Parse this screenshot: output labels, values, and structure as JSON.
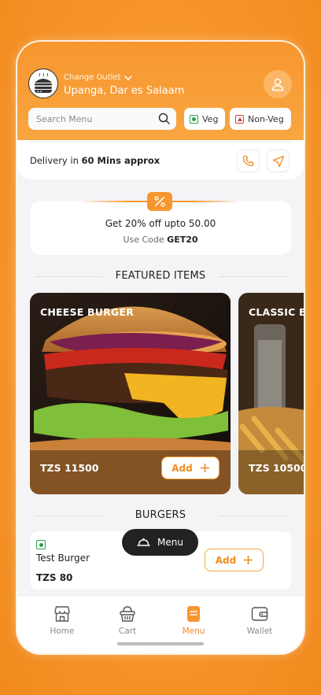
{
  "colors": {
    "accent": "#f7962f",
    "veg": "#2aa14a",
    "non_veg": "#d63b3b",
    "fab": "#222222"
  },
  "header": {
    "outlet_label": "Change Outlet",
    "outlet_name": "Upanga, Dar es Salaam",
    "search_placeholder": "Search Menu",
    "filters": {
      "veg": "Veg",
      "non_veg": "Non-Veg"
    }
  },
  "delivery": {
    "prefix": "Delivery in ",
    "time": "60 Mins approx"
  },
  "promo": {
    "title": "Get 20% off upto 50.00",
    "code_prefix": "Use Code ",
    "code": "GET20"
  },
  "featured": {
    "title": "FEATURED ITEMS",
    "items": [
      {
        "name": "CHEESE BURGER",
        "price": "TZS 11500",
        "add_label": "Add"
      },
      {
        "name": "CLASSIC BURGER",
        "price": "TZS 10500"
      }
    ]
  },
  "burgers": {
    "title": "BURGERS",
    "items": [
      {
        "name": "Test Burger",
        "price": "TZS 80",
        "add_label": "Add"
      }
    ]
  },
  "menu_fab": {
    "label": "Menu"
  },
  "nav": {
    "home": "Home",
    "cart": "Cart",
    "menu": "Menu",
    "wallet": "Wallet"
  }
}
